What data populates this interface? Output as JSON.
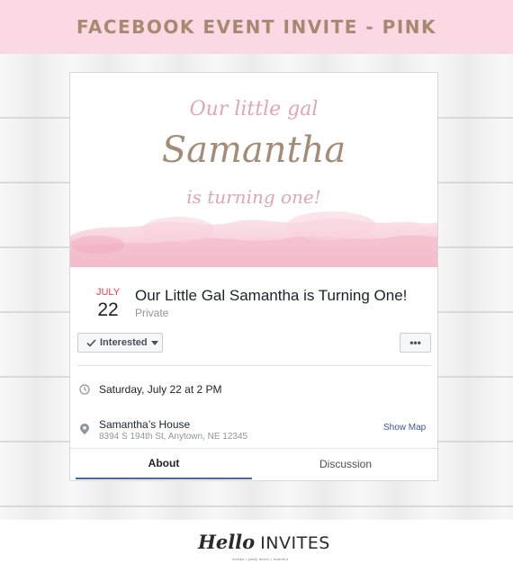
{
  "banner": {
    "title": "FACEBOOK EVENT INVITE - PINK"
  },
  "cover": {
    "line1": "Our little gal",
    "name": "Samantha",
    "line3": "is turning one!"
  },
  "event": {
    "month": "JULY",
    "day": "22",
    "title": "Our Little Gal Samantha is Turning One!",
    "privacy": "Private"
  },
  "actions": {
    "interested_label": "Interested",
    "more_label": "•••"
  },
  "details": {
    "time": "Saturday, July 22 at 2 PM",
    "place_name": "Samantha’s House",
    "place_address": "8394 S 194th St, Anytown, NE 12345",
    "show_map": "Show Map"
  },
  "tabs": [
    {
      "label": "About",
      "active": true
    },
    {
      "label": "Discussion",
      "active": false
    }
  ],
  "footer": {
    "logo_script": "Hello",
    "logo_word": "INVITES",
    "tagline": "invites • party decor • banners"
  },
  "colors": {
    "banner_bg": "#fbd9e4",
    "banner_text": "#a58a72",
    "accent_pink": "#dfa6b5",
    "name_taupe": "#a48d78",
    "date_red": "#e0424d",
    "link_blue": "#365899",
    "tab_underline": "#4267b2"
  },
  "icons": {
    "clock": "clock-icon",
    "location": "location-pin-icon",
    "check": "check-icon",
    "caret": "caret-down-icon"
  }
}
